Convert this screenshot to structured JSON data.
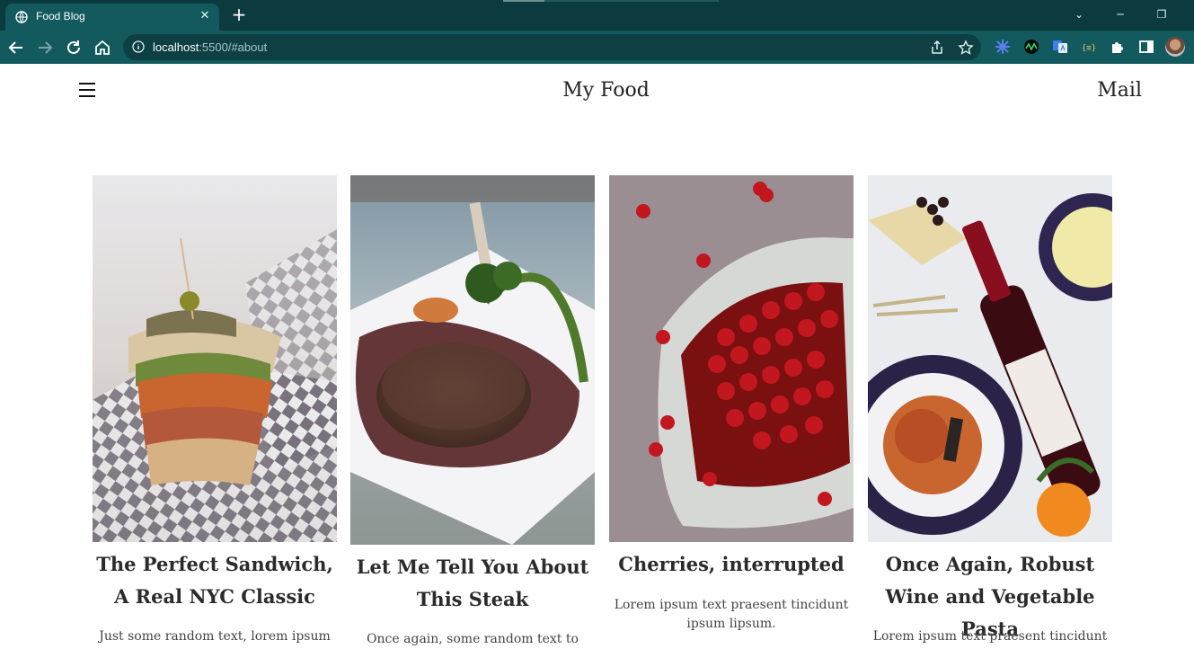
{
  "browser": {
    "tab_title": "Food Blog",
    "url_host": "localhost",
    "url_rest": ":5500/#about"
  },
  "header": {
    "title": "My Food",
    "mail_label": "Mail"
  },
  "cards": [
    {
      "title": "The Perfect Sandwich, A Real NYC Classic",
      "text": "Just some random text, lorem ipsum text"
    },
    {
      "title": "Let Me Tell You About This Steak",
      "text": "Once again, some random text to lorem"
    },
    {
      "title": "Cherries, interrupted",
      "text": "Lorem ipsum text praesent tincidunt ipsum lipsum."
    },
    {
      "title": "Once Again, Robust Wine and Vegetable Pasta",
      "text": "Lorem ipsum text praesent tincidunt"
    }
  ],
  "colors": {
    "chrome_dark": "#0b3b3f",
    "chrome_toolbar": "#135a5e"
  }
}
